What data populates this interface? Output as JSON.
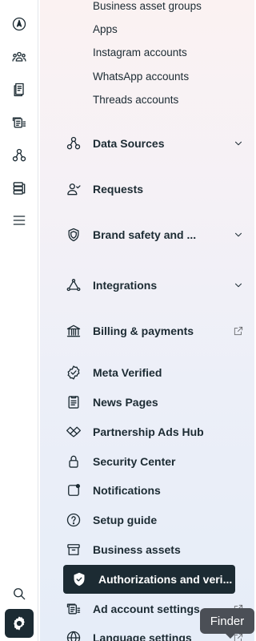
{
  "rail": {
    "icons": [
      "compass-icon",
      "people-icon",
      "pages-icon",
      "ad-accounts-icon",
      "data-sources-icon",
      "catalog-icon",
      "menu-icon",
      "search-icon",
      "settings-icon"
    ]
  },
  "panel": {
    "sub_items": [
      "Business asset groups",
      "Apps",
      "Instagram accounts",
      "WhatsApp accounts",
      "Threads accounts"
    ],
    "items": [
      {
        "label": "Data Sources",
        "icon": "data-sources-icon",
        "trail": "chevron-down-icon"
      },
      {
        "label": "Requests",
        "icon": "person-check-icon",
        "trail": ""
      },
      {
        "label": "Brand safety and ...",
        "icon": "shield-icon",
        "trail": "chevron-down-icon"
      },
      {
        "label": "Integrations",
        "icon": "integrations-icon",
        "trail": "chevron-down-icon"
      },
      {
        "label": "Billing & payments",
        "icon": "bank-icon",
        "trail": "external-link-icon"
      },
      {
        "label": "Meta Verified",
        "icon": "verified-badge-icon",
        "trail": ""
      },
      {
        "label": "News Pages",
        "icon": "news-icon",
        "trail": ""
      },
      {
        "label": "Partnership Ads Hub",
        "icon": "handshake-icon",
        "trail": ""
      },
      {
        "label": "Security Center",
        "icon": "lock-icon",
        "trail": ""
      },
      {
        "label": "Notifications",
        "icon": "notification-icon",
        "trail": ""
      },
      {
        "label": "Setup guide",
        "icon": "help-icon",
        "trail": ""
      },
      {
        "label": "Business assets",
        "icon": "archive-icon",
        "trail": ""
      },
      {
        "label": "Authorizations and veri...",
        "icon": "shield-check-icon",
        "trail": ""
      },
      {
        "label": "Ad account settings",
        "icon": "ad-account-icon",
        "trail": "external-link-icon"
      },
      {
        "label": "Language settings",
        "icon": "globe-icon",
        "trail": "external-link-icon"
      }
    ]
  },
  "tooltip": {
    "text": "Finder"
  }
}
